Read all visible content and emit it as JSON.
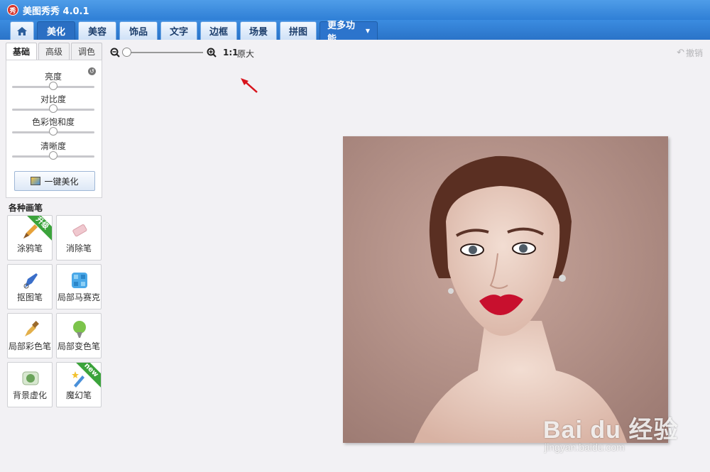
{
  "titlebar": {
    "logo_char": "秀",
    "title": "美图秀秀 4.0.1"
  },
  "tabs": [
    {
      "label": "美化",
      "active": true
    },
    {
      "label": "美容"
    },
    {
      "label": "饰品"
    },
    {
      "label": "文字"
    },
    {
      "label": "边框"
    },
    {
      "label": "场景"
    },
    {
      "label": "拼图"
    },
    {
      "label": "更多功能"
    }
  ],
  "subtabs": [
    "基础",
    "高级",
    "调色"
  ],
  "sliders": [
    {
      "label": "亮度",
      "value": 0.5
    },
    {
      "label": "对比度",
      "value": 0.5
    },
    {
      "label": "色彩饱和度",
      "value": 0.5
    },
    {
      "label": "清晰度",
      "value": 0.5
    }
  ],
  "one_click_label": "一键美化",
  "brushes_title": "各种画笔",
  "brushes": [
    {
      "label": "涂鸦笔",
      "icon": "crayon-brush-icon",
      "badge": "升级"
    },
    {
      "label": "消除笔",
      "icon": "eraser-icon"
    },
    {
      "label": "抠图笔",
      "icon": "cutout-pen-icon"
    },
    {
      "label": "局部马赛克",
      "icon": "mosaic-icon"
    },
    {
      "label": "局部彩色笔",
      "icon": "color-brush-icon"
    },
    {
      "label": "局部变色笔",
      "icon": "color-change-icon"
    },
    {
      "label": "背景虚化",
      "icon": "blur-icon"
    },
    {
      "label": "魔幻笔",
      "icon": "magic-pen-icon",
      "badge": "new"
    }
  ],
  "zoom": {
    "ratio": "1:1",
    "original": "原大",
    "level": 0.0
  },
  "undo_label": "撤销",
  "watermark": {
    "main": "Bai du 经验",
    "sub": "jingyan.baidu.com"
  }
}
